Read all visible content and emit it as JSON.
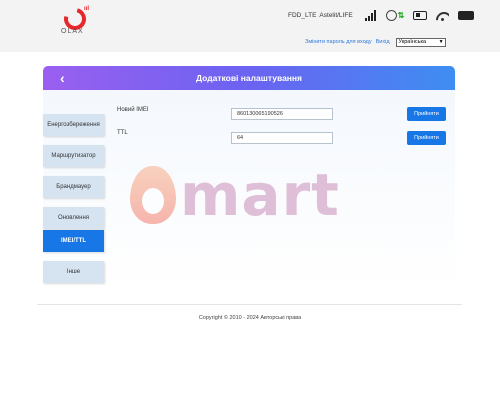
{
  "header": {
    "logo_text": "OLAX",
    "network": "FDD_LTE",
    "operator": "Astelit/LIFE",
    "data_arrows": "⇅",
    "links": {
      "change_password": "Змінити пароль для входу",
      "logout": "Вихід"
    },
    "language": "Українська"
  },
  "card": {
    "title": "Додаткові налаштування",
    "back_icon": "‹"
  },
  "sidebar": {
    "items": [
      {
        "label": "Енергозбереження"
      },
      {
        "label": "Маршрутизатор"
      },
      {
        "label": "Брандмауер"
      },
      {
        "label": "Оновлення"
      },
      {
        "label": "IMEI/TTL",
        "active": true
      },
      {
        "label": "Інше"
      }
    ]
  },
  "form": {
    "imei_label": "Новий IMEI",
    "imei_value": "860130065190526",
    "imei_apply": "Прийняти",
    "ttl_label": "TTL",
    "ttl_value": "64",
    "ttl_apply": "Прийняти"
  },
  "watermark": {
    "text": "mart"
  },
  "footer": {
    "copyright": "Copyright © 2010 - 2024 Авторські права"
  },
  "colors": {
    "accent": "#1877e7",
    "header_gradient_start": "#9a5ff0",
    "header_gradient_end": "#3e8ef2",
    "brand_red": "#e8262b"
  }
}
